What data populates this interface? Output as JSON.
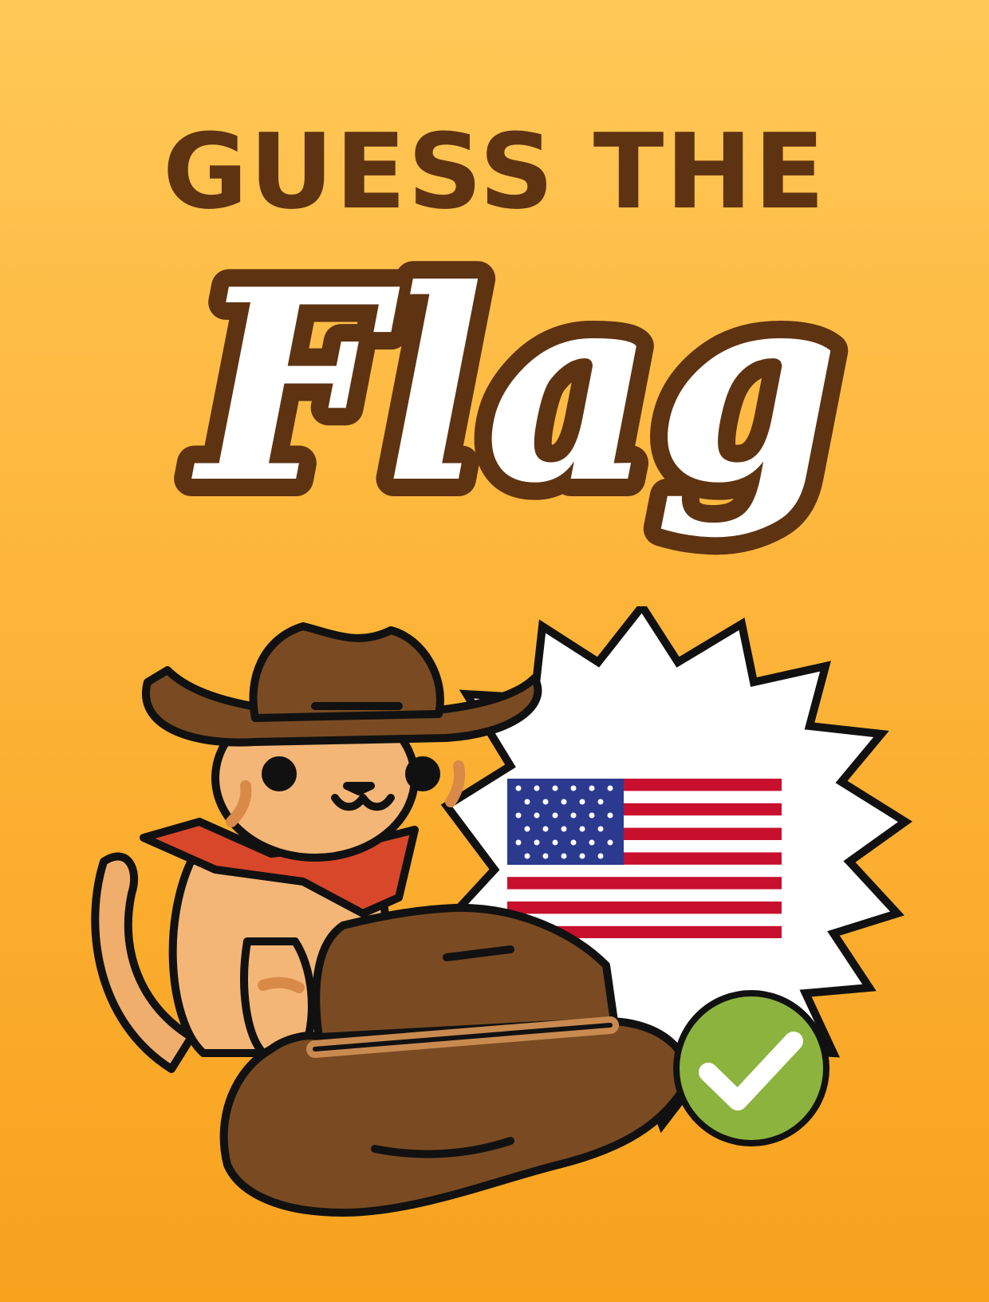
{
  "title": {
    "line1": "GUESS THE",
    "line2": "Flag"
  },
  "flag": {
    "country_icon": "usa-flag-icon"
  },
  "answer_status": "correct-checkmark-icon",
  "colors": {
    "background_top": "#FFC857",
    "background_bottom": "#F8A21E",
    "title_brown": "#5E3312",
    "check_green": "#8CB33E"
  }
}
